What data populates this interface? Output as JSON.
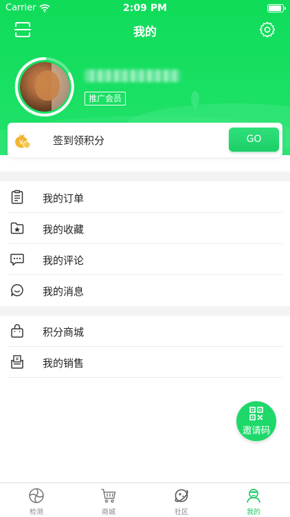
{
  "status_bar": {
    "carrier": "Carrier",
    "time": "2:09 PM"
  },
  "nav": {
    "title": "我的",
    "left_icon": "scan-icon",
    "right_icon": "gear-icon"
  },
  "profile": {
    "member_badge": "推广会员",
    "username_blurred": true
  },
  "signin": {
    "label": "签到领积分",
    "button": "GO",
    "icon": "coin-bag-icon"
  },
  "menu_group_1": [
    {
      "label": "我的订单",
      "icon": "clipboard-icon"
    },
    {
      "label": "我的收藏",
      "icon": "star-folder-icon"
    },
    {
      "label": "我的评论",
      "icon": "comment-icon"
    },
    {
      "label": "我的消息",
      "icon": "message-icon"
    }
  ],
  "menu_group_2": [
    {
      "label": "积分商城",
      "icon": "shopping-bag-icon"
    },
    {
      "label": "我的销售",
      "icon": "sales-box-icon"
    }
  ],
  "invite": {
    "label": "邀请码",
    "icon": "qr-code-icon"
  },
  "tabbar": [
    {
      "label": "检测",
      "icon": "detect-icon",
      "active": false
    },
    {
      "label": "商城",
      "icon": "cart-icon",
      "active": false
    },
    {
      "label": "社区",
      "icon": "planet-icon",
      "active": false
    },
    {
      "label": "我的",
      "icon": "profile-icon",
      "active": true
    }
  ],
  "colors": {
    "primary_green": "#1ed86a",
    "header_green": "#0fdc59",
    "active_tab": "#20c766"
  }
}
